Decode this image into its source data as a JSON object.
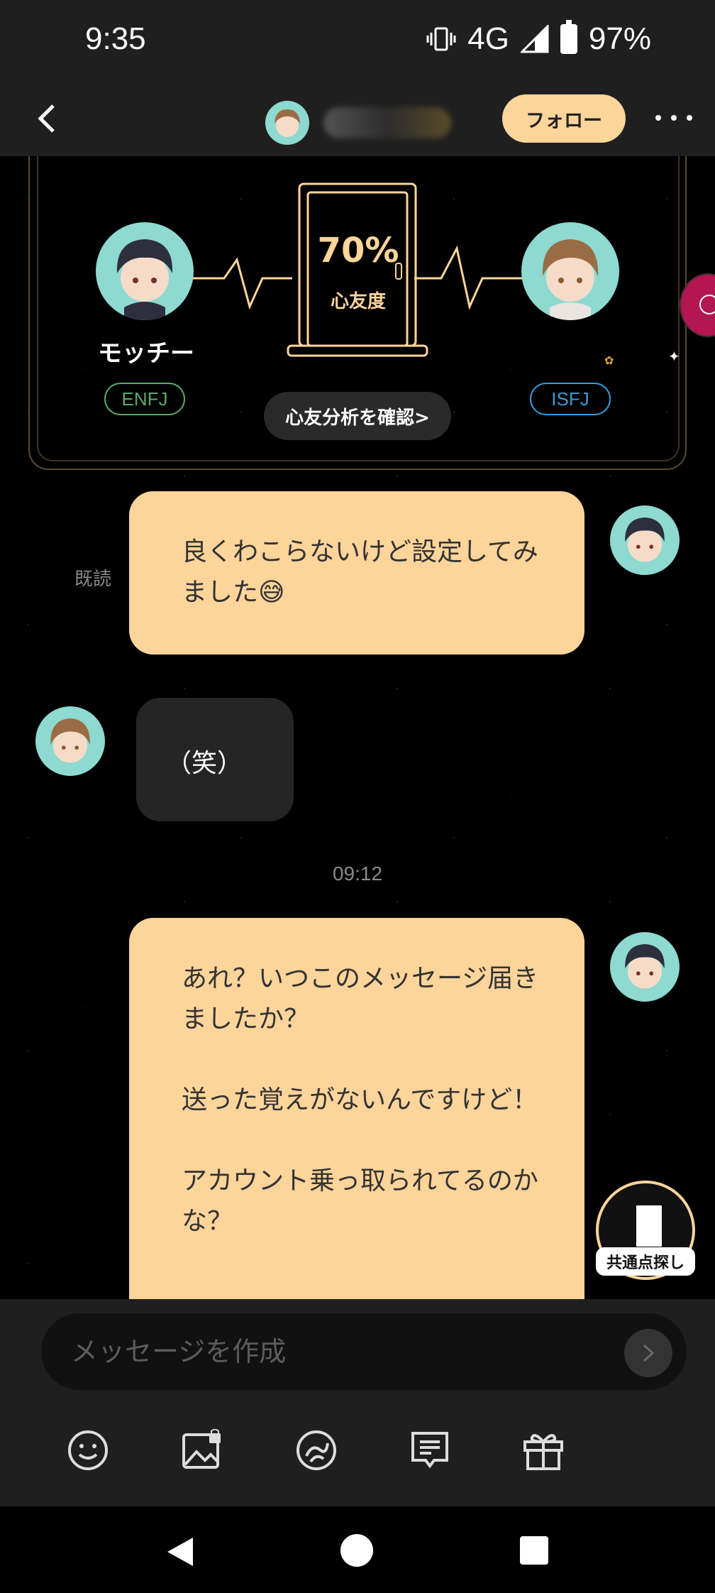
{
  "status_bar": {
    "time": "9:35",
    "network": "4G",
    "battery": "97%"
  },
  "header": {
    "follow_label": "フォロー"
  },
  "friendship_card": {
    "left_user": {
      "name": "モッチー",
      "mbti": "ENFJ"
    },
    "right_user": {
      "mbti": "ISFJ"
    },
    "percent": "70%",
    "percent_label": "心友度",
    "analysis_button": "心友分析を確認>"
  },
  "messages": {
    "read_label": "既読",
    "msg1": "良くわこらないけど設定してみました😅",
    "msg2": "（笑）",
    "timestamp": "09:12",
    "msg3": [
      "あれ？いつこのメッセージ届きましたか？",
      "送った覚えがないんですけど！",
      "アカウント乗っ取られてるのかな？"
    ]
  },
  "floating": {
    "mutual_label": "共通点探し"
  },
  "input": {
    "placeholder": "メッセージを作成"
  },
  "toolbar": {
    "icons": [
      "emoji-icon",
      "image-icon",
      "sticker-icon",
      "template-icon",
      "gift-icon"
    ]
  },
  "colors": {
    "accent": "#fdd49a",
    "bubble_other": "#252525",
    "avatar_bg": "#8ed9d0"
  }
}
